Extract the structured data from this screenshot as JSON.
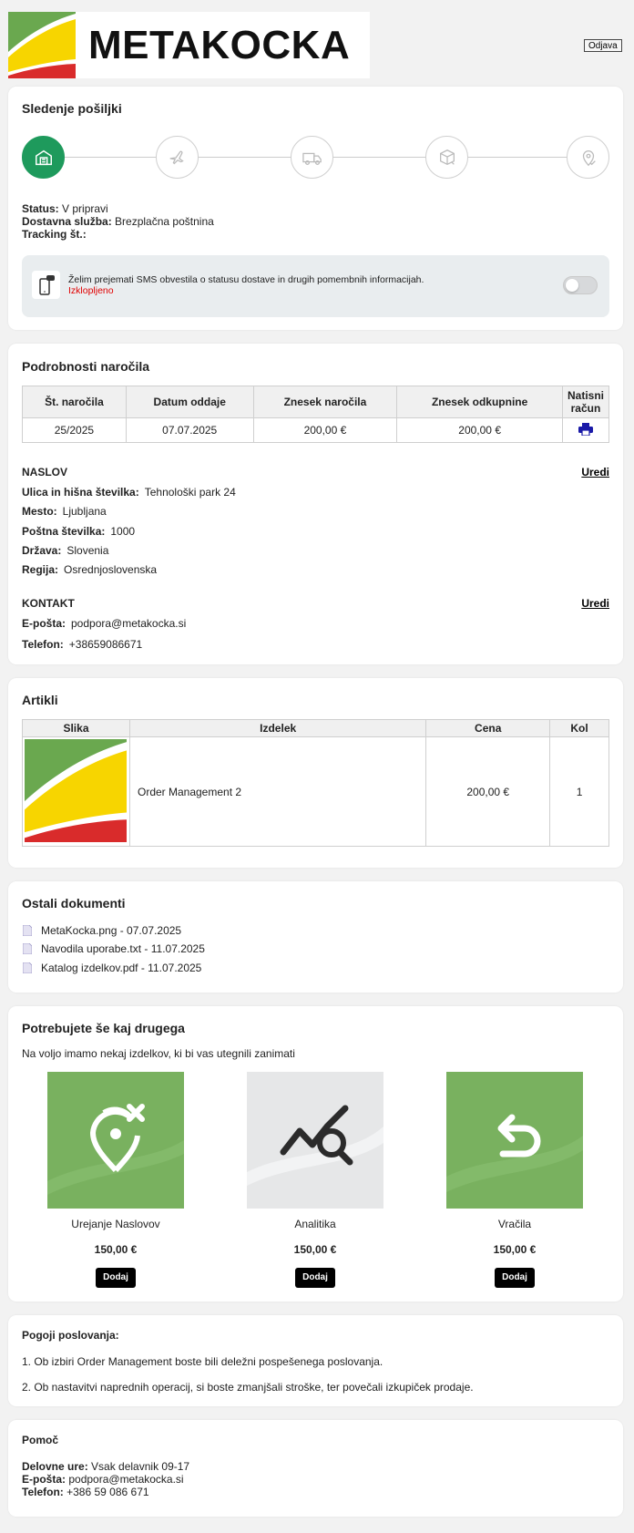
{
  "header": {
    "logo_text": "METAKOCKA",
    "logout_label": "Odjava"
  },
  "tracking": {
    "title": "Sledenje pošiljki",
    "steps": [
      "warehouse-icon",
      "plane-icon",
      "truck-icon",
      "package-icon",
      "location-check-icon"
    ],
    "active_step": 0,
    "status_label": "Status:",
    "status_value": "V pripravi",
    "service_label": "Dostavna služba:",
    "service_value": "Brezplačna poštnina",
    "tracking_label": "Tracking št.:",
    "tracking_value": "",
    "sms_text": "Želim prejemati SMS obvestila o statusu dostave in drugih pomembnih informacijah.",
    "sms_status": "Izklopljeno",
    "colors": {
      "active": "#1e9a5c",
      "off": "#e00000"
    }
  },
  "order": {
    "title": "Podrobnosti naročila",
    "headers": [
      "Št. naročila",
      "Datum oddaje",
      "Znesek naročila",
      "Znesek odkupnine",
      "Natisni račun"
    ],
    "row": [
      "25/2025",
      "07.07.2025",
      "200,00 €",
      "200,00 €"
    ],
    "address": {
      "heading": "NASLOV",
      "edit": "Uredi",
      "fields": [
        {
          "label": "Ulica in hišna številka:",
          "value": "Tehnološki park 24"
        },
        {
          "label": "Mesto:",
          "value": "Ljubljana"
        },
        {
          "label": "Poštna številka:",
          "value": "1000"
        },
        {
          "label": "Država:",
          "value": "Slovenia"
        },
        {
          "label": "Regija:",
          "value": "Osrednjoslovenska"
        }
      ]
    },
    "contact": {
      "heading": "KONTAKT",
      "edit": "Uredi",
      "fields": [
        {
          "label": "E-pošta:",
          "value": "podpora@metakocka.si"
        },
        {
          "label": "Telefon:",
          "value": "+38659086671"
        }
      ]
    }
  },
  "articles": {
    "title": "Artikli",
    "headers": [
      "Slika",
      "Izdelek",
      "Cena",
      "Kol"
    ],
    "row": {
      "name": "Order Management 2",
      "price": "200,00 €",
      "qty": "1"
    }
  },
  "documents": {
    "title": "Ostali dokumenti",
    "items": [
      "MetaKocka.png - 07.07.2025",
      "Navodila uporabe.txt - 11.07.2025",
      "Katalog izdelkov.pdf - 11.07.2025"
    ]
  },
  "upsell": {
    "title": "Potrebujete še kaj drugega",
    "subtitle": "Na voljo imamo nekaj izdelkov, ki bi vas utegnili zanimati",
    "products": [
      {
        "name": "Urejanje Naslovov",
        "price": "150,00 €",
        "button": "Dodaj",
        "icon": "location-remove-icon"
      },
      {
        "name": "Analitika",
        "price": "150,00 €",
        "button": "Dodaj",
        "icon": "analytics-icon"
      },
      {
        "name": "Vračila",
        "price": "150,00 €",
        "button": "Dodaj",
        "icon": "return-icon"
      }
    ]
  },
  "terms": {
    "title": "Pogoji poslovanja:",
    "items": [
      "1. Ob izbiri Order Management boste bili deležni pospešenega poslovanja.",
      "2. Ob nastavitvi naprednih operacij, si boste zmanjšali stroške, ter povečali izkupiček prodaje."
    ]
  },
  "help": {
    "title": "Pomoč",
    "hours_label": "Delovne ure:",
    "hours_value": "Vsak delavnik 09-17",
    "email_label": "E-pošta:",
    "email_value": "podpora@metakocka.si",
    "phone_label": "Telefon:",
    "phone_value": "+386 59 086 671"
  }
}
